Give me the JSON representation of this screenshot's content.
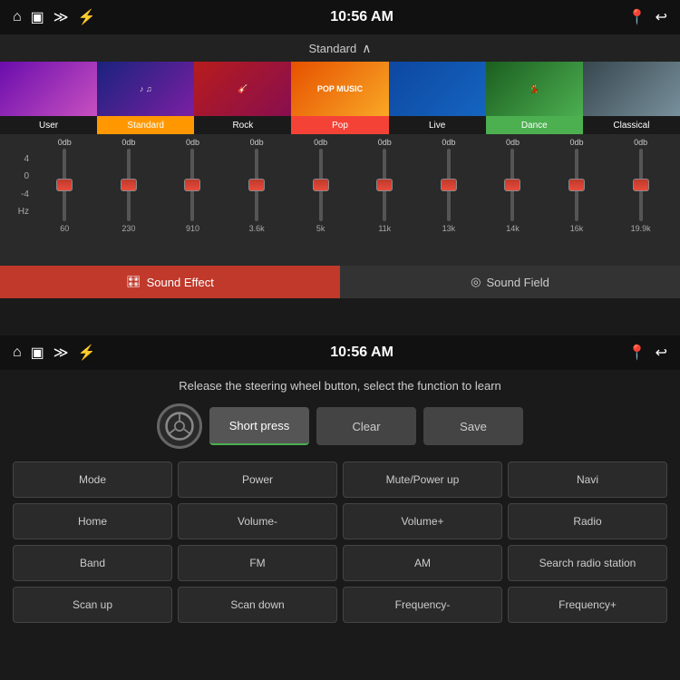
{
  "top": {
    "statusBar": {
      "time": "10:56 AM",
      "icons": [
        "⌂",
        "▣",
        "≫",
        "⚡"
      ]
    },
    "presetBar": {
      "label": "Standard",
      "chevron": "^"
    },
    "presets": [
      {
        "id": "user",
        "label": "User",
        "bgClass": "thumb-user",
        "active": false
      },
      {
        "id": "standard",
        "label": "Standard",
        "bgClass": "thumb-standard",
        "active": true
      },
      {
        "id": "rock",
        "label": "Rock",
        "bgClass": "thumb-rock",
        "active": false
      },
      {
        "id": "pop",
        "label": "Pop",
        "bgClass": "thumb-pop",
        "active": false
      },
      {
        "id": "live",
        "label": "Live",
        "bgClass": "thumb-live",
        "active": false
      },
      {
        "id": "dance",
        "label": "Dance",
        "bgClass": "thumb-dance",
        "active": false
      },
      {
        "id": "classical",
        "label": "Classical",
        "bgClass": "thumb-classical",
        "active": false
      }
    ],
    "eq": {
      "dbLabels": [
        "4",
        "0",
        "-4"
      ],
      "freqs": [
        {
          "hz": "60",
          "db": "0db"
        },
        {
          "hz": "230",
          "db": "0db"
        },
        {
          "hz": "910",
          "db": "0db"
        },
        {
          "hz": "3.6k",
          "db": "0db"
        },
        {
          "hz": "5k",
          "db": "0db"
        },
        {
          "hz": "11k",
          "db": "0db"
        },
        {
          "hz": "13k",
          "db": "0db"
        },
        {
          "hz": "14k",
          "db": "0db"
        },
        {
          "hz": "16k",
          "db": "0db"
        },
        {
          "hz": "19.9k",
          "db": "0db"
        }
      ],
      "hzLabel": "Hz"
    },
    "tabs": {
      "soundEffect": "Sound Effect",
      "soundField": "Sound Field"
    }
  },
  "bottom": {
    "statusBar": {
      "time": "10:56 AM"
    },
    "instruction": "Release the steering wheel button, select the function to learn",
    "controls": {
      "shortPress": "Short press",
      "clear": "Clear",
      "save": "Save"
    },
    "functions": [
      "Mode",
      "Power",
      "Mute/Power up",
      "Navi",
      "Home",
      "Volume-",
      "Volume+",
      "Radio",
      "Band",
      "FM",
      "AM",
      "Search radio station",
      "Scan up",
      "Scan down",
      "Frequency-",
      "Frequency+"
    ]
  }
}
